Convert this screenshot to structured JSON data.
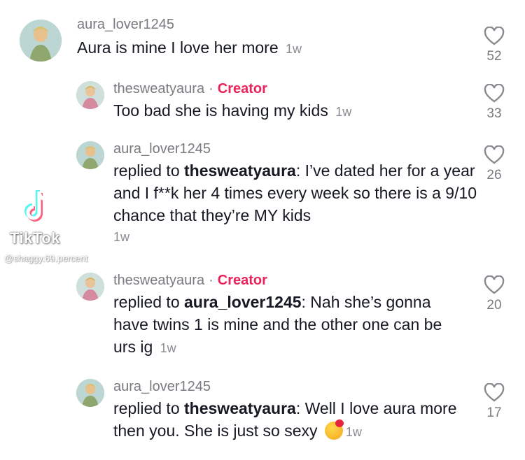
{
  "comments": [
    {
      "username": "aura_lover1245",
      "text": "Aura is mine I love her more",
      "time": "1w",
      "likes": "52"
    },
    {
      "username": "thesweatyaura",
      "badge": "Creator",
      "text": "Too bad she is having my kids",
      "time": "1w",
      "likes": "33"
    },
    {
      "username": "aura_lover1245",
      "replied_prefix": "replied to ",
      "replied_to": "thesweatyaura",
      "text": ": I’ve dated her for a year and I f**k her 4 times every week so there is a 9/10 chance that they’re MY kids",
      "time": "1w",
      "likes": "26"
    },
    {
      "username": "thesweatyaura",
      "badge": "Creator",
      "replied_prefix": "replied to ",
      "replied_to": "aura_lover1245",
      "text": ": Nah she’s gonna have twins 1 is mine and the other one can be urs ig",
      "time": "1w",
      "likes": "20"
    },
    {
      "username": "aura_lover1245",
      "replied_prefix": "replied to ",
      "replied_to": "thesweatyaura",
      "text": ": Well I love aura more then you. She is just so sexy",
      "emoji": "smiling-face-with-hearts",
      "time": "1w",
      "likes": "17"
    }
  ],
  "watermark": {
    "brand": "TikTok",
    "handle": "@shaggy.69.percent"
  },
  "colors": {
    "creator": "#e8245a",
    "text": "#161823",
    "muted": "#7a7a80"
  }
}
